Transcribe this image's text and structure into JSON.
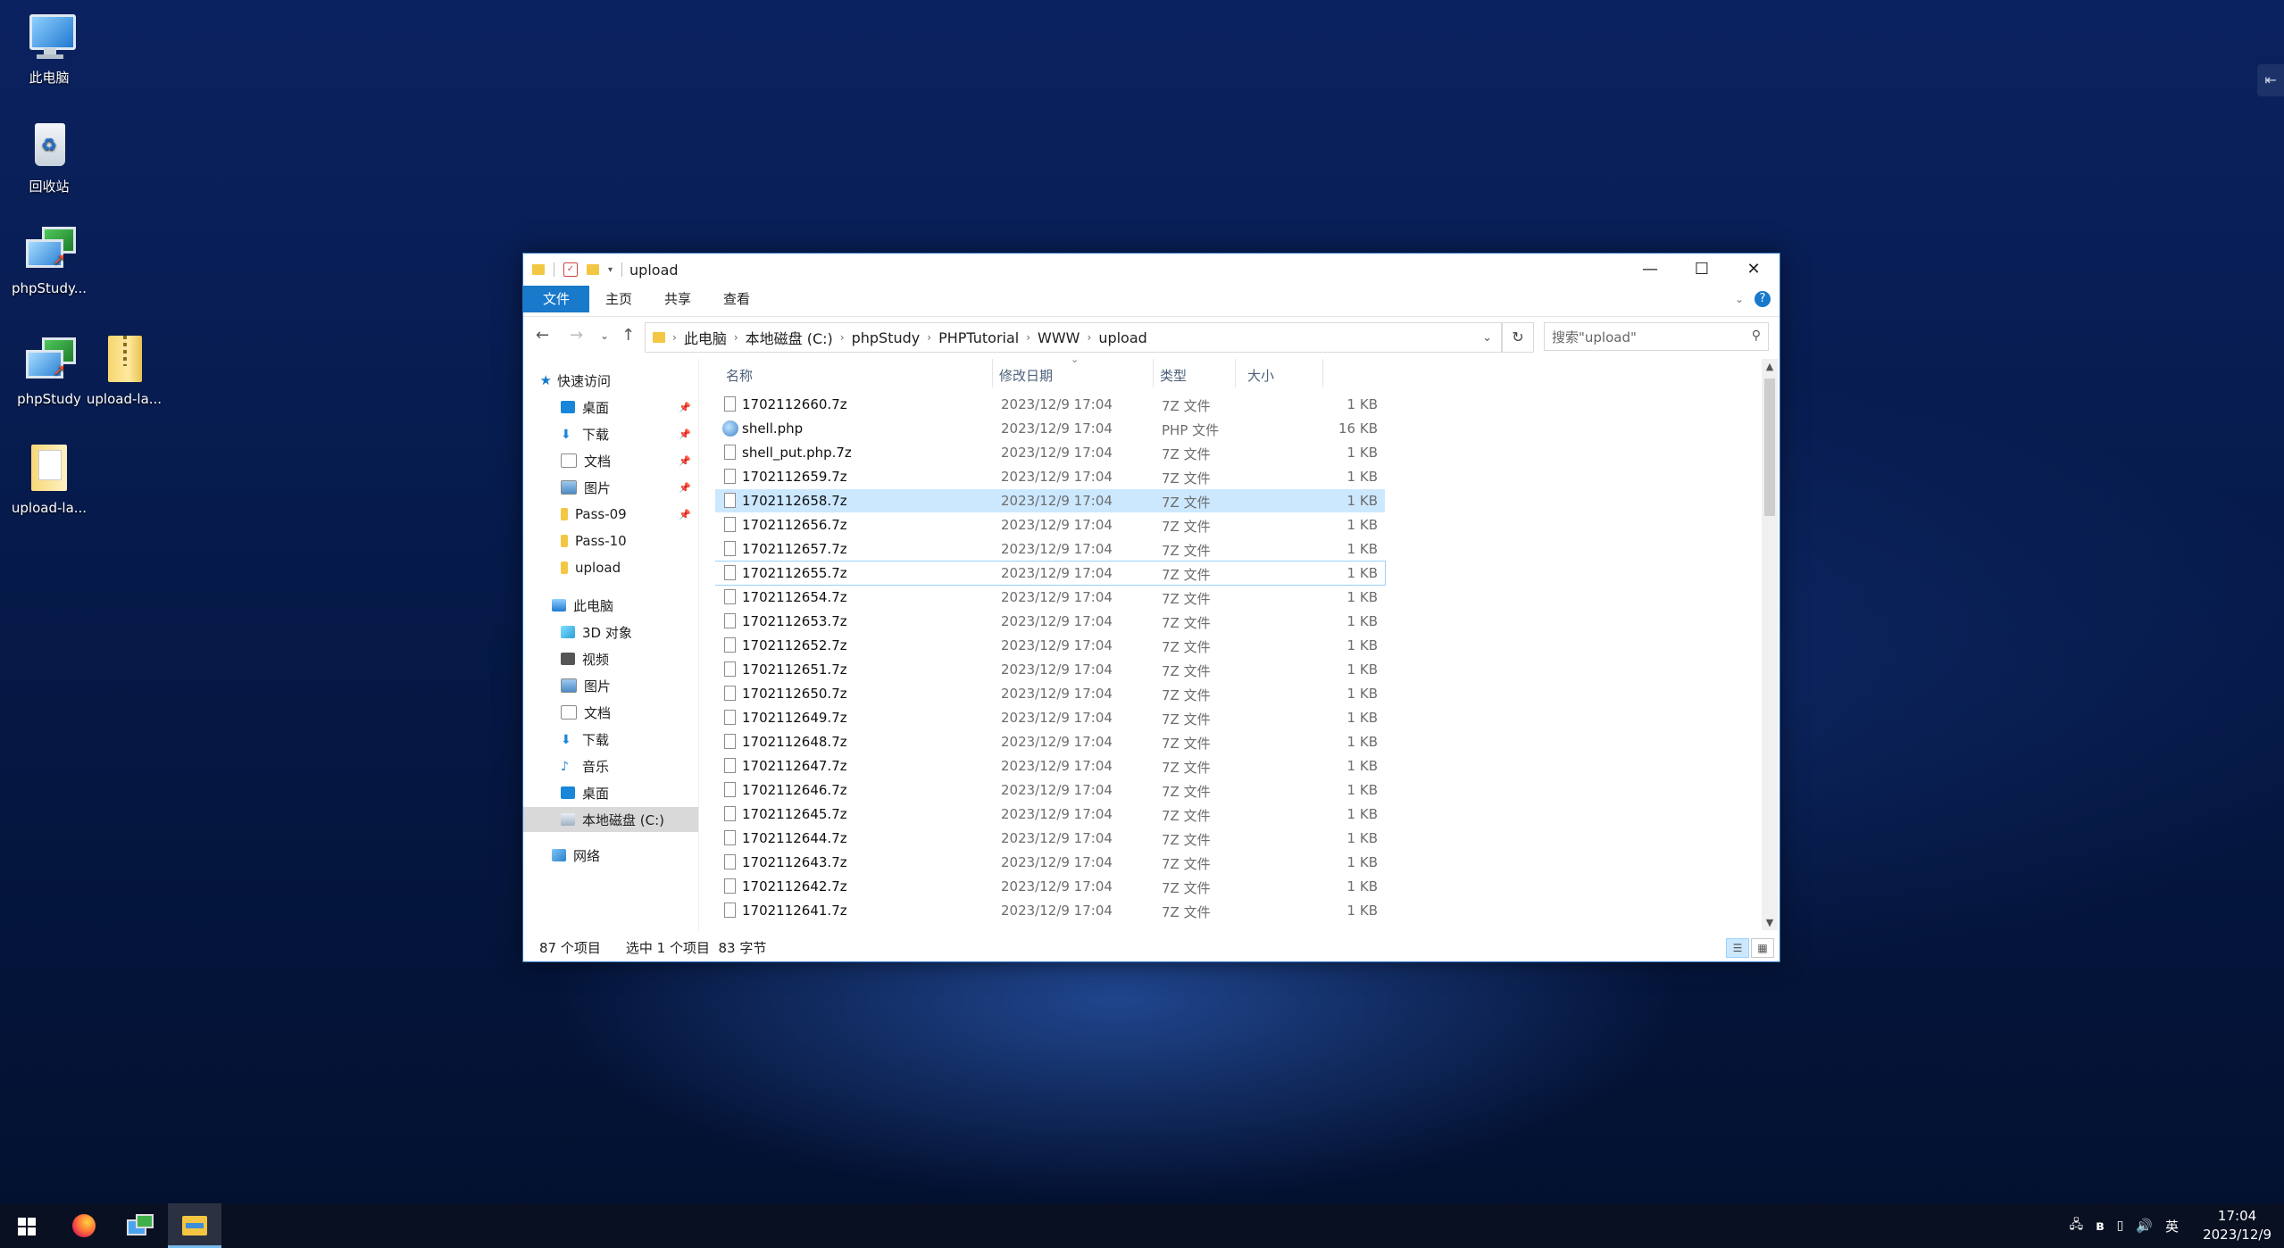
{
  "desktop": {
    "icons": [
      {
        "label": "此电脑"
      },
      {
        "label": "回收站"
      },
      {
        "label": "phpStudy..."
      },
      {
        "label": "phpStudy"
      },
      {
        "label": "upload-la..."
      },
      {
        "label": "upload-la..."
      }
    ]
  },
  "window": {
    "title": "upload",
    "controls": {
      "minimize": "—",
      "maximize": "☐",
      "close": "✕"
    },
    "ribbon_tabs": [
      "文件",
      "主页",
      "共享",
      "查看"
    ],
    "breadcrumb": [
      "此电脑",
      "本地磁盘 (C:)",
      "phpStudy",
      "PHPTutorial",
      "WWW",
      "upload"
    ],
    "search_placeholder": "搜索\"upload\"",
    "columns": {
      "name": "名称",
      "date": "修改日期",
      "type": "类型",
      "size": "大小"
    },
    "nav": {
      "quick_access": "快速访问",
      "quick_items": [
        "桌面",
        "下载",
        "文档",
        "图片",
        "Pass-09",
        "Pass-10",
        "upload"
      ],
      "this_pc": "此电脑",
      "pc_items": [
        "3D 对象",
        "视频",
        "图片",
        "文档",
        "下载",
        "音乐",
        "桌面",
        "本地磁盘 (C:)"
      ],
      "network": "网络"
    },
    "files": [
      {
        "name": "1702112660.7z",
        "date": "2023/12/9 17:04",
        "type": "7Z 文件",
        "size": "1 KB"
      },
      {
        "name": "shell.php",
        "date": "2023/12/9 17:04",
        "type": "PHP 文件",
        "size": "16 KB"
      },
      {
        "name": "shell_put.php.7z",
        "date": "2023/12/9 17:04",
        "type": "7Z 文件",
        "size": "1 KB"
      },
      {
        "name": "1702112659.7z",
        "date": "2023/12/9 17:04",
        "type": "7Z 文件",
        "size": "1 KB"
      },
      {
        "name": "1702112658.7z",
        "date": "2023/12/9 17:04",
        "type": "7Z 文件",
        "size": "1 KB"
      },
      {
        "name": "1702112656.7z",
        "date": "2023/12/9 17:04",
        "type": "7Z 文件",
        "size": "1 KB"
      },
      {
        "name": "1702112657.7z",
        "date": "2023/12/9 17:04",
        "type": "7Z 文件",
        "size": "1 KB"
      },
      {
        "name": "1702112655.7z",
        "date": "2023/12/9 17:04",
        "type": "7Z 文件",
        "size": "1 KB"
      },
      {
        "name": "1702112654.7z",
        "date": "2023/12/9 17:04",
        "type": "7Z 文件",
        "size": "1 KB"
      },
      {
        "name": "1702112653.7z",
        "date": "2023/12/9 17:04",
        "type": "7Z 文件",
        "size": "1 KB"
      },
      {
        "name": "1702112652.7z",
        "date": "2023/12/9 17:04",
        "type": "7Z 文件",
        "size": "1 KB"
      },
      {
        "name": "1702112651.7z",
        "date": "2023/12/9 17:04",
        "type": "7Z 文件",
        "size": "1 KB"
      },
      {
        "name": "1702112650.7z",
        "date": "2023/12/9 17:04",
        "type": "7Z 文件",
        "size": "1 KB"
      },
      {
        "name": "1702112649.7z",
        "date": "2023/12/9 17:04",
        "type": "7Z 文件",
        "size": "1 KB"
      },
      {
        "name": "1702112648.7z",
        "date": "2023/12/9 17:04",
        "type": "7Z 文件",
        "size": "1 KB"
      },
      {
        "name": "1702112647.7z",
        "date": "2023/12/9 17:04",
        "type": "7Z 文件",
        "size": "1 KB"
      },
      {
        "name": "1702112646.7z",
        "date": "2023/12/9 17:04",
        "type": "7Z 文件",
        "size": "1 KB"
      },
      {
        "name": "1702112645.7z",
        "date": "2023/12/9 17:04",
        "type": "7Z 文件",
        "size": "1 KB"
      },
      {
        "name": "1702112644.7z",
        "date": "2023/12/9 17:04",
        "type": "7Z 文件",
        "size": "1 KB"
      },
      {
        "name": "1702112643.7z",
        "date": "2023/12/9 17:04",
        "type": "7Z 文件",
        "size": "1 KB"
      },
      {
        "name": "1702112642.7z",
        "date": "2023/12/9 17:04",
        "type": "7Z 文件",
        "size": "1 KB"
      },
      {
        "name": "1702112641.7z",
        "date": "2023/12/9 17:04",
        "type": "7Z 文件",
        "size": "1 KB"
      }
    ],
    "selected_file": "1702112658.7z",
    "status": {
      "count": "87 个项目",
      "selection": "选中 1 个项目  83 字节"
    }
  },
  "taskbar": {
    "tray_lang": "英",
    "time": "17:04",
    "date": "2023/12/9"
  },
  "colors": {
    "accent": "#1979ca",
    "selection": "#cce8ff"
  }
}
